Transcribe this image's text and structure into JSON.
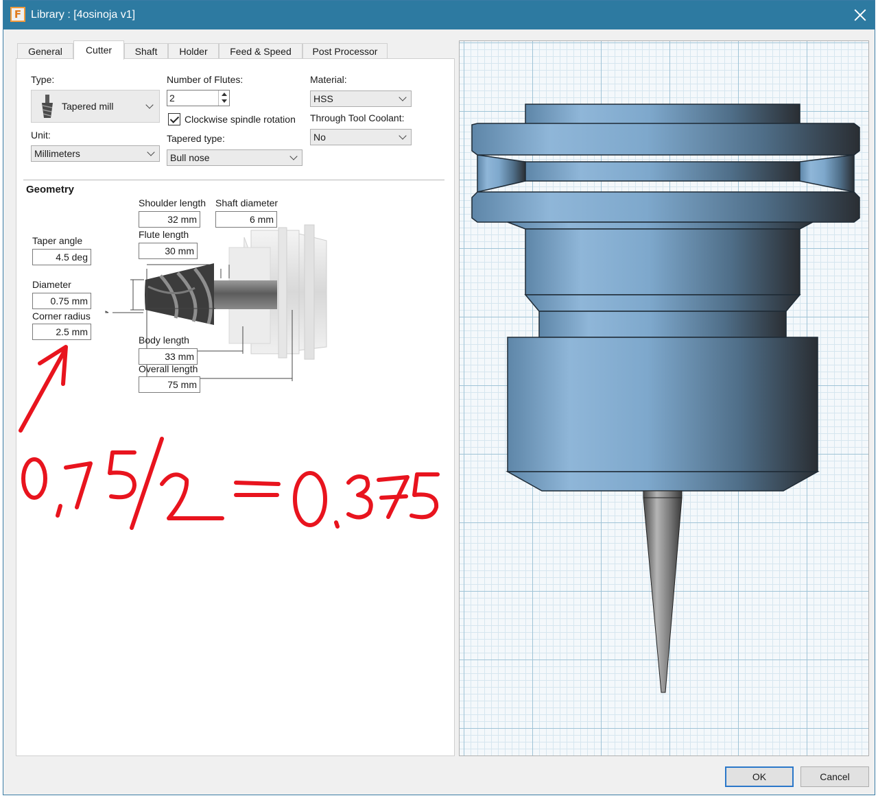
{
  "window": {
    "title": "Library : [4osinoja v1]",
    "app_icon_glyph": "F"
  },
  "tabs": [
    {
      "label": "General",
      "active": false
    },
    {
      "label": "Cutter",
      "active": true
    },
    {
      "label": "Shaft",
      "active": false
    },
    {
      "label": "Holder",
      "active": false
    },
    {
      "label": "Feed & Speed",
      "active": false
    },
    {
      "label": "Post Processor",
      "active": false
    }
  ],
  "cutter": {
    "type_label": "Type:",
    "type_value": "Tapered mill",
    "unit_label": "Unit:",
    "unit_value": "Millimeters",
    "flutes_label": "Number of Flutes:",
    "flutes_value": "2",
    "clockwise_label": "Clockwise spindle rotation",
    "clockwise_checked": true,
    "tapered_type_label": "Tapered type:",
    "tapered_type_value": "Bull nose",
    "material_label": "Material:",
    "material_value": "HSS",
    "coolant_label": "Through Tool Coolant:",
    "coolant_value": "No"
  },
  "geometry": {
    "title": "Geometry",
    "shoulder_length_label": "Shoulder length",
    "shoulder_length_value": "32 mm",
    "shaft_diameter_label": "Shaft diameter",
    "shaft_diameter_value": "6 mm",
    "flute_length_label": "Flute length",
    "flute_length_value": "30 mm",
    "taper_angle_label": "Taper angle",
    "taper_angle_value": "4.5 deg",
    "diameter_label": "Diameter",
    "diameter_value": "0.75 mm",
    "corner_radius_label": "Corner radius",
    "corner_radius_value": "2.5 mm",
    "body_length_label": "Body length",
    "body_length_value": "33 mm",
    "overall_length_label": "Overall length",
    "overall_length_value": "75 mm"
  },
  "annotation": {
    "handwritten_text": "0,75/2=0.375",
    "color": "#e8141e"
  },
  "buttons": {
    "ok": "OK",
    "cancel": "Cancel"
  },
  "colors": {
    "titlebar": "#2d7aa1",
    "holder_blue": "#7ea8cc",
    "tool_gray": "#6e6e6e"
  }
}
